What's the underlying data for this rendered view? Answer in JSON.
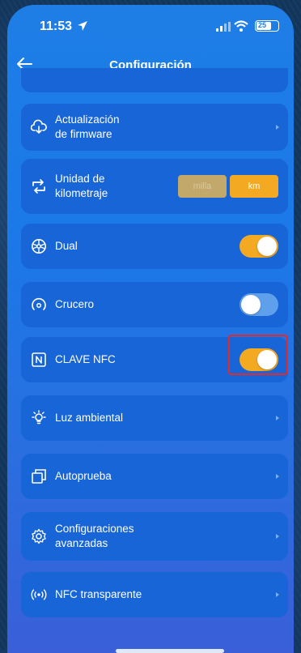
{
  "status_bar": {
    "time": "11:53",
    "battery": "25"
  },
  "header": {
    "title": "Configuración"
  },
  "rows": {
    "firmware": {
      "label_line1": "Actualización",
      "label_line2": "de firmware"
    },
    "odometer": {
      "label_line1": "Unidad de",
      "label_line2": "kilometraje",
      "unit_mile": "milla",
      "unit_km": "km",
      "selected_unit": "km"
    },
    "dual": {
      "label": "Dual",
      "enabled": true
    },
    "cruise": {
      "label": "Crucero",
      "enabled": false
    },
    "nfc_key": {
      "label": "CLAVE NFC",
      "enabled": true
    },
    "ambient": {
      "label": "Luz ambiental"
    },
    "self_test": {
      "label": "Autoprueba"
    },
    "advanced": {
      "label_line1": "Configuraciones",
      "label_line2": "avanzadas"
    },
    "nfc_transparent": {
      "label": "NFC transparente"
    }
  },
  "colors": {
    "accent": "#f3a922",
    "card": "#1765d6",
    "highlight": "#e32a2a"
  }
}
